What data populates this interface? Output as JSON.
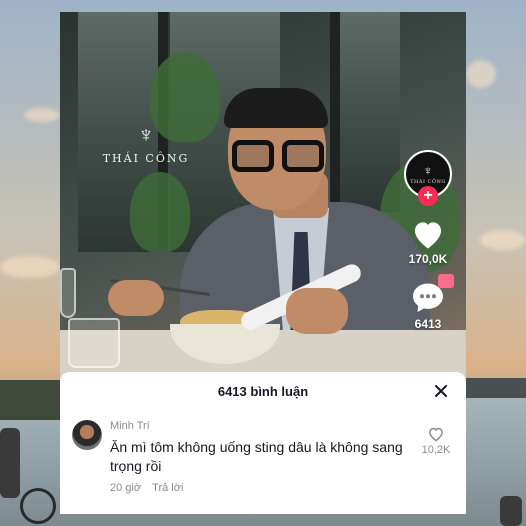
{
  "brand": {
    "name": "THÁI CÔNG"
  },
  "rail": {
    "avatar_text": "THÁI CÔNG",
    "follow_symbol": "+",
    "like_count": "170,0K",
    "comment_count": "6413"
  },
  "comments_panel": {
    "title": "6413 bình luận",
    "comments": [
      {
        "username": "Minh Trí",
        "text": "Ăn mì tôm không uống sting dâu là không sang trọng rồi",
        "time": "20 giờ",
        "reply_label": "Trả lời",
        "like_count": "10,2K"
      }
    ]
  },
  "colors": {
    "accent": "#fe2c55",
    "sheet_bg": "#ffffff",
    "muted_text": "#8a8b91"
  }
}
